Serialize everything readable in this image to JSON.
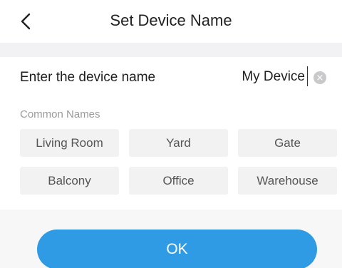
{
  "header": {
    "title": "Set Device Name",
    "back_icon": "chevron-left-icon"
  },
  "name_field": {
    "label": "Enter the device name",
    "value": "My Device",
    "clear_icon": "clear-circle-icon"
  },
  "common_names": {
    "label": "Common Names",
    "items": [
      "Living Room",
      "Yard",
      "Gate",
      "Balcony",
      "Office",
      "Warehouse"
    ]
  },
  "actions": {
    "ok_label": "OK"
  },
  "colors": {
    "accent": "#2f9be4",
    "background": "#f7f7f8",
    "chip_background": "#f2f2f2"
  }
}
